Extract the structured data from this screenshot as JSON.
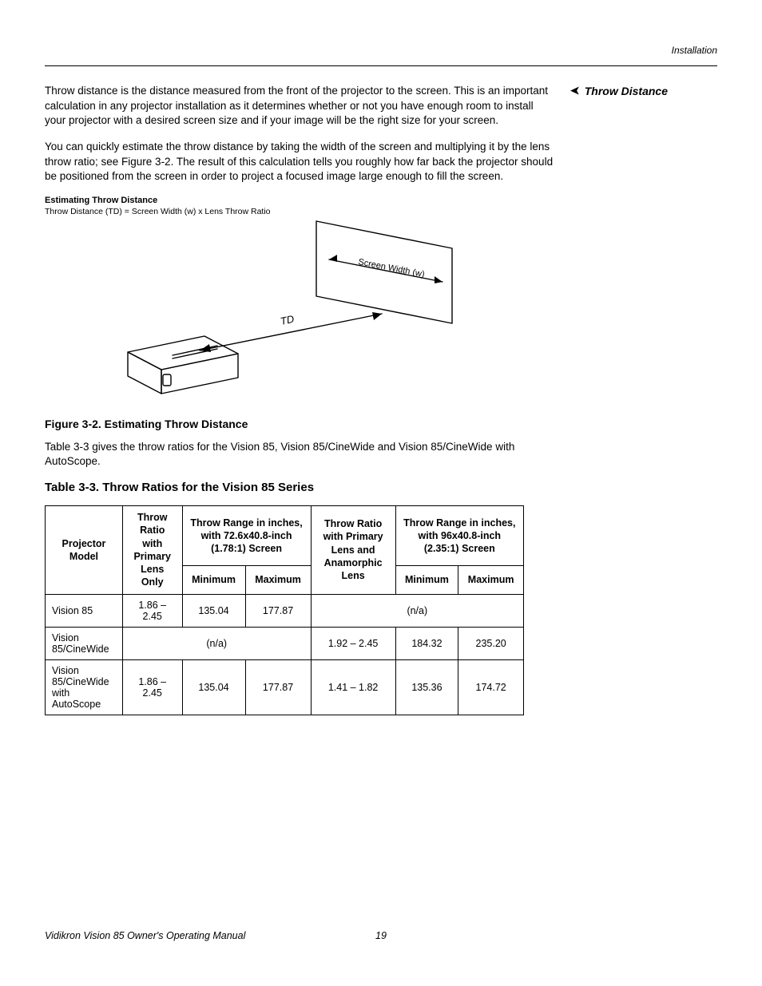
{
  "header": {
    "section": "Installation"
  },
  "side": {
    "arrow": "➤",
    "heading": "Throw Distance"
  },
  "paragraphs": {
    "p1": "Throw distance is the distance measured from the front of the projector to the screen. This is an important calculation in any projector installation as it determines whether or not you have enough room to install your projector with a desired screen size and if your image will be the right size for your screen.",
    "p2": "You can quickly estimate the throw distance by taking the width of the screen and multiplying it by the lens throw ratio; see Figure 3-2. The result of this calculation tells you roughly how far back the projector should be positioned from the screen in order to project a focused image large enough to fill the screen.",
    "p3": "Table 3-3 gives the throw ratios for the Vision 85, Vision 85/CineWide and Vision 85/CineWide with AutoScope."
  },
  "diagram": {
    "title": "Estimating Throw Distance",
    "formula": "Throw Distance (TD)  =  Screen Width (w)  x  Lens Throw Ratio",
    "screen_label": "Screen Width (w)",
    "td_label": "TD"
  },
  "figure_caption": "Figure 3-2. Estimating Throw Distance",
  "table_title": "Table 3-3. Throw Ratios for the Vision 85 Series",
  "table": {
    "headers": {
      "model": "Projector Model",
      "ratio_primary": "Throw Ratio with Primary Lens Only",
      "range178": "Throw Range in inches, with 72.6x40.8-inch (1.78:1) Screen",
      "ratio_anamorphic": "Throw Ratio with Primary Lens and Anamorphic Lens",
      "range235": "Throw Range in inches, with 96x40.8-inch (2.35:1) Screen",
      "min": "Minimum",
      "max": "Maximum"
    },
    "rows": [
      {
        "model": "Vision 85",
        "ratio_primary": "1.86 – 2.45",
        "min178": "135.04",
        "max178": "177.87",
        "ratio_anamorphic": "(n/a)",
        "min235": "",
        "max235": "",
        "na_right": true
      },
      {
        "model": "Vision 85/CineWide",
        "ratio_primary": "(n/a)",
        "min178": "",
        "max178": "",
        "na_left": true,
        "ratio_anamorphic": "1.92 – 2.45",
        "min235": "184.32",
        "max235": "235.20"
      },
      {
        "model": "Vision 85/CineWide with AutoScope",
        "ratio_primary": "1.86 – 2.45",
        "min178": "135.04",
        "max178": "177.87",
        "ratio_anamorphic": "1.41 – 1.82",
        "min235": "135.36",
        "max235": "174.72"
      }
    ]
  },
  "footer": {
    "left": "Vidikron Vision 85 Owner's Operating Manual",
    "page": "19"
  }
}
